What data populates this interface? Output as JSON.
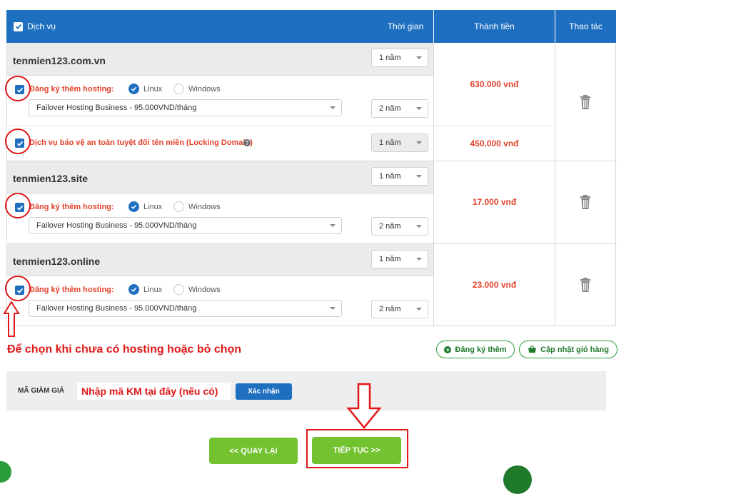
{
  "header": {
    "service": "Dịch vụ",
    "time": "Thời gian",
    "total": "Thành tiền",
    "action": "Thao tác"
  },
  "domains": [
    {
      "name": "tenmien123.com.vn",
      "period": "1 năm",
      "hosting_label": "Đăng ký thêm hosting:",
      "os_linux": "Linux",
      "os_windows": "Windows",
      "hosting_plan": "Failover Hosting Business - 95.000VND/tháng",
      "hosting_period": "2 năm",
      "price": "630.000 vnđ",
      "lock_label": "Dịch vụ bảo vệ an toàn tuyệt đối tên miền (Locking Domain)",
      "lock_period": "1 năm",
      "lock_price": "450.000 vnđ"
    },
    {
      "name": "tenmien123.site",
      "period": "1 năm",
      "hosting_label": "Đăng ký thêm hosting:",
      "os_linux": "Linux",
      "os_windows": "Windows",
      "hosting_plan": "Failover Hosting Business - 95.000VND/tháng",
      "hosting_period": "2 năm",
      "price": "17.000 vnđ"
    },
    {
      "name": "tenmien123.online",
      "period": "1 năm",
      "hosting_label": "Đăng ký thêm hosting:",
      "os_linux": "Linux",
      "os_windows": "Windows",
      "hosting_plan": "Failover Hosting Business - 95.000VND/tháng",
      "hosting_period": "2 năm",
      "price": "23.000 vnđ"
    }
  ],
  "annotation_note": "Để chọn khi chưa có hosting hoặc bỏ chọn",
  "buttons": {
    "register_more": "Đăng ký thêm",
    "update_cart": "Cập nhật giỏ hàng",
    "confirm": "Xác nhận",
    "back": "<< QUAY LẠI",
    "continue": "TIẾP TỤC >>"
  },
  "coupon": {
    "label": "MÃ GIẢM GIÁ",
    "placeholder": "Nhập mã KM tại đây (nếu có)"
  },
  "colors": {
    "header_blue": "#1f6fc0",
    "price_red": "#e2422a",
    "annotation_red": "#e01818",
    "button_green": "#73c230"
  }
}
